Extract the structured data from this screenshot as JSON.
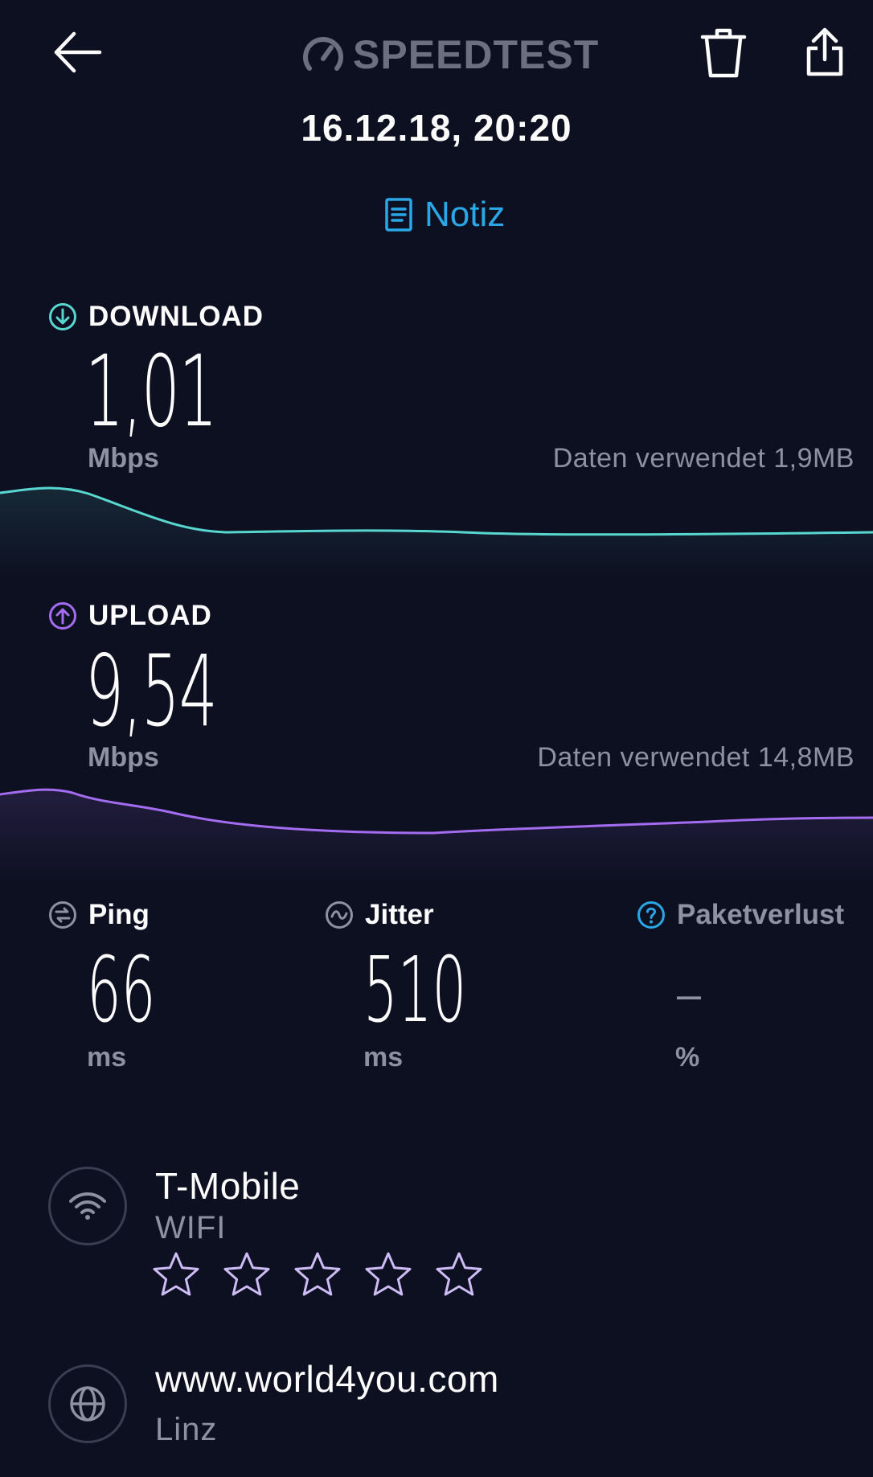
{
  "header": {
    "brand": "SPEEDTEST",
    "date": "16.12.18, 20:20",
    "note_label": "Notiz"
  },
  "download": {
    "label": "DOWNLOAD",
    "value": "1,01",
    "unit": "Mbps",
    "data_used": "Daten verwendet 1,9MB",
    "color": "#58d7d1"
  },
  "upload": {
    "label": "UPLOAD",
    "value": "9,54",
    "unit": "Mbps",
    "data_used": "Daten verwendet 14,8MB",
    "color": "#a46cf0"
  },
  "ping": {
    "label": "Ping",
    "value": "66",
    "unit": "ms"
  },
  "jitter": {
    "label": "Jitter",
    "value": "510",
    "unit": "ms"
  },
  "packet_loss": {
    "label": "Paketverlust",
    "value": "–",
    "unit": "%"
  },
  "provider": {
    "name": "T-Mobile",
    "connection": "WIFI",
    "rating_stars": 5
  },
  "server": {
    "host": "www.world4you.com",
    "city": "Linz"
  },
  "icons": {
    "back": "back-arrow-icon",
    "delete": "trash-icon",
    "share": "share-icon",
    "note": "note-icon",
    "wifi": "wifi-icon",
    "globe": "globe-icon"
  }
}
